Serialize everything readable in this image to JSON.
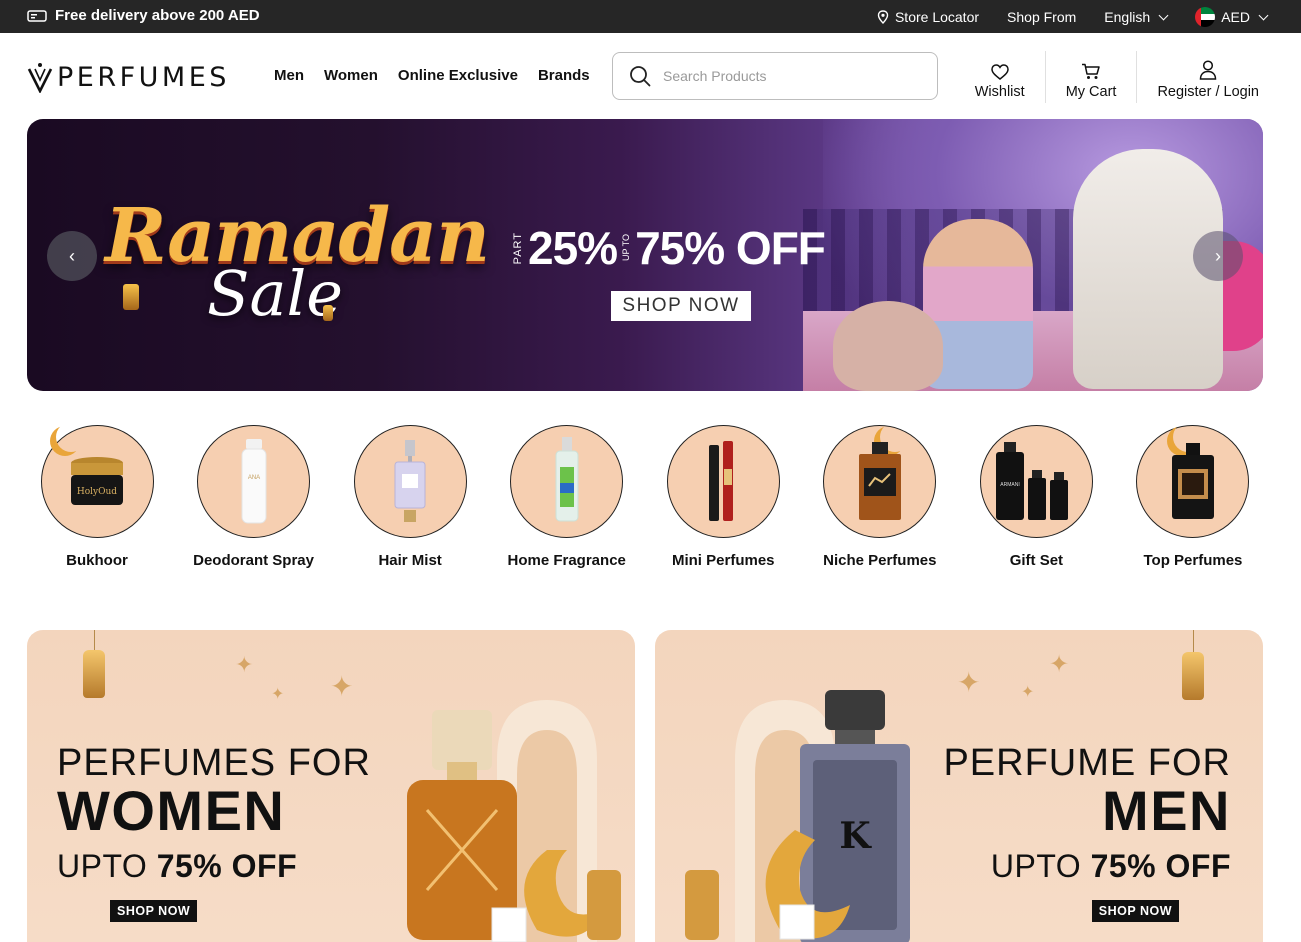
{
  "topbar": {
    "promo": "Free delivery above 200 AED",
    "store_locator": "Store Locator",
    "shop_from": "Shop From",
    "language": "English",
    "currency": "AED"
  },
  "header": {
    "logo_text": "PERFUMES",
    "nav": [
      "Men",
      "Women",
      "Online Exclusive",
      "Brands"
    ],
    "search_placeholder": "Search Products",
    "wishlist": "Wishlist",
    "cart": "My Cart",
    "account": "Register / Login"
  },
  "hero": {
    "title_line1": "Ramadan",
    "title_line2": "Sale",
    "part_label": "PART",
    "offer_low": "25%",
    "upto_label": "UP TO",
    "offer_high": "75% OFF",
    "cta": "SHOP NOW"
  },
  "categories": [
    "Bukhoor",
    "Deodorant Spray",
    "Hair Mist",
    "Home Fragrance",
    "Mini Perfumes",
    "Niche Perfumes",
    "Gift Set",
    "Top Perfumes"
  ],
  "banners": {
    "women": {
      "line1": "PERFUMES FOR",
      "line2": "WOMEN",
      "line3_prefix": "UPTO",
      "line3_value": "75% OFF",
      "cta": "SHOP NOW"
    },
    "men": {
      "line1": "PERFUME FOR",
      "line2": "MEN",
      "line3_prefix": "UPTO",
      "line3_value": "75% OFF",
      "cta": "SHOP NOW"
    }
  },
  "colors": {
    "topbar_bg": "#262626",
    "banner_bg": "#f3d5bd",
    "category_bg": "#f6cfb1"
  }
}
